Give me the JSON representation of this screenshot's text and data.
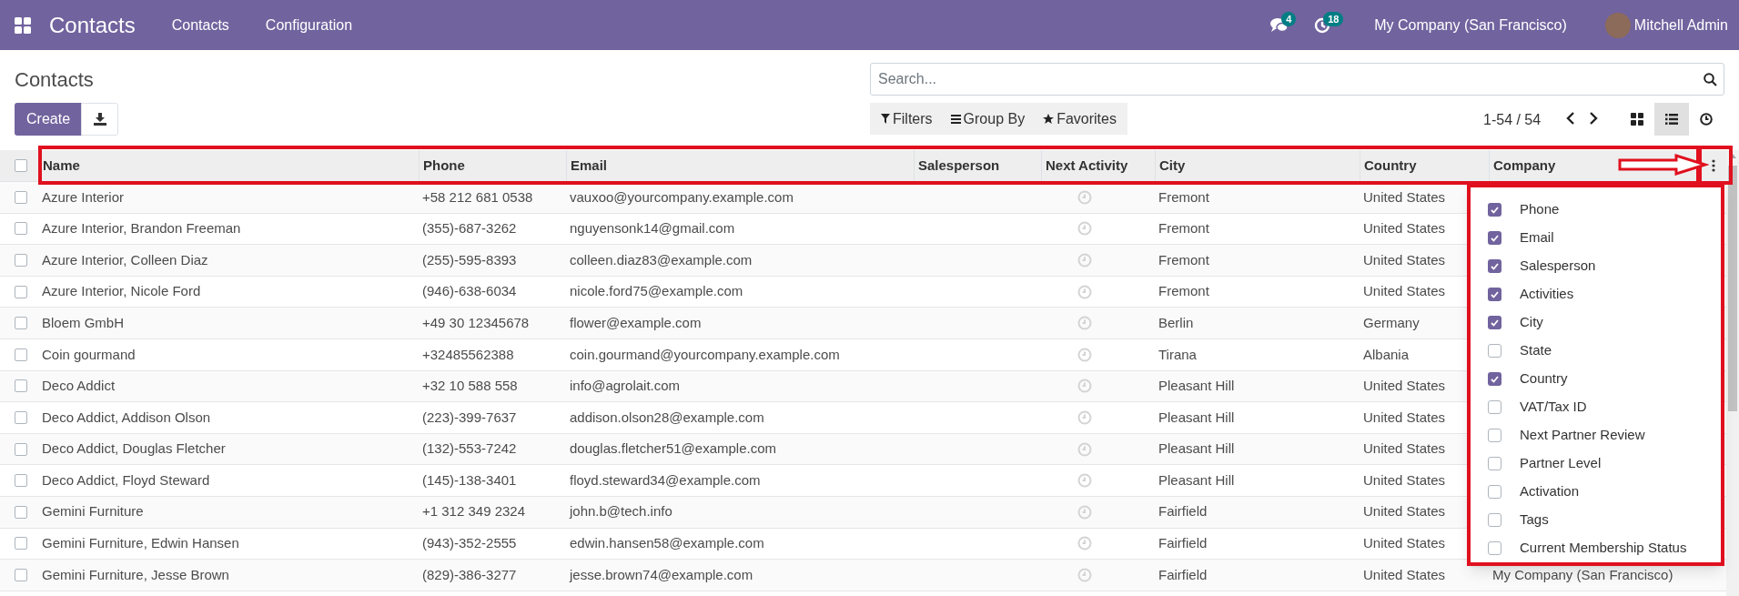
{
  "navbar": {
    "app_title": "Contacts",
    "menu": [
      "Contacts",
      "Configuration"
    ],
    "messages_badge": "4",
    "activities_badge": "18",
    "company": "My Company (San Francisco)",
    "user": "Mitchell Admin"
  },
  "breadcrumb": "Contacts",
  "buttons": {
    "create": "Create"
  },
  "search": {
    "placeholder": "Search..."
  },
  "filters": [
    "Filters",
    "Group By",
    "Favorites"
  ],
  "pager": "1-54 / 54",
  "views": [
    {
      "kind": "kanban",
      "selected": false
    },
    {
      "kind": "list",
      "selected": true
    },
    {
      "kind": "activity",
      "selected": false
    }
  ],
  "table": {
    "all_selected": false,
    "columns": [
      "Name",
      "Phone",
      "Email",
      "Salesperson",
      "Next Activity",
      "City",
      "Country",
      "Company"
    ],
    "rows": [
      {
        "selected": false,
        "name": "Azure Interior",
        "phone": "+58 212 681 0538",
        "email": "vauxoo@yourcompany.example.com",
        "city": "Fremont",
        "country": "United States"
      },
      {
        "selected": false,
        "name": "Azure Interior, Brandon Freeman",
        "phone": "(355)-687-3262",
        "email": "nguyensonk14@gmail.com",
        "city": "Fremont",
        "country": "United States"
      },
      {
        "selected": false,
        "name": "Azure Interior, Colleen Diaz",
        "phone": "(255)-595-8393",
        "email": "colleen.diaz83@example.com",
        "city": "Fremont",
        "country": "United States"
      },
      {
        "selected": false,
        "name": "Azure Interior, Nicole Ford",
        "phone": "(946)-638-6034",
        "email": "nicole.ford75@example.com",
        "city": "Fremont",
        "country": "United States"
      },
      {
        "selected": false,
        "name": "Bloem GmbH",
        "phone": "+49 30 12345678",
        "email": "flower@example.com",
        "city": "Berlin",
        "country": "Germany"
      },
      {
        "selected": false,
        "name": "Coin gourmand",
        "phone": "+32485562388",
        "email": "coin.gourmand@yourcompany.example.com",
        "city": "Tirana",
        "country": "Albania"
      },
      {
        "selected": false,
        "name": "Deco Addict",
        "phone": "+32 10 588 558",
        "email": "info@agrolait.com",
        "city": "Pleasant Hill",
        "country": "United States"
      },
      {
        "selected": false,
        "name": "Deco Addict, Addison Olson",
        "phone": "(223)-399-7637",
        "email": "addison.olson28@example.com",
        "city": "Pleasant Hill",
        "country": "United States"
      },
      {
        "selected": false,
        "name": "Deco Addict, Douglas Fletcher",
        "phone": "(132)-553-7242",
        "email": "douglas.fletcher51@example.com",
        "city": "Pleasant Hill",
        "country": "United States"
      },
      {
        "selected": false,
        "name": "Deco Addict, Floyd Steward",
        "phone": "(145)-138-3401",
        "email": "floyd.steward34@example.com",
        "city": "Pleasant Hill",
        "country": "United States"
      },
      {
        "selected": false,
        "name": "Gemini Furniture",
        "phone": "+1 312 349 2324",
        "email": "john.b@tech.info",
        "city": "Fairfield",
        "country": "United States"
      },
      {
        "selected": false,
        "name": "Gemini Furniture, Edwin Hansen",
        "phone": "(943)-352-2555",
        "email": "edwin.hansen58@example.com",
        "city": "Fairfield",
        "country": "United States"
      },
      {
        "selected": false,
        "name": "Gemini Furniture, Jesse Brown",
        "phone": "(829)-386-3277",
        "email": "jesse.brown74@example.com",
        "city": "Fairfield",
        "country": "United States",
        "company": "My Company (San Francisco)"
      }
    ]
  },
  "optional_columns": [
    {
      "label": "Phone",
      "checked": true
    },
    {
      "label": "Email",
      "checked": true
    },
    {
      "label": "Salesperson",
      "checked": true
    },
    {
      "label": "Activities",
      "checked": true
    },
    {
      "label": "City",
      "checked": true
    },
    {
      "label": "State",
      "checked": false
    },
    {
      "label": "Country",
      "checked": true
    },
    {
      "label": "VAT/Tax ID",
      "checked": false
    },
    {
      "label": "Next Partner Review",
      "checked": false
    },
    {
      "label": "Partner Level",
      "checked": false
    },
    {
      "label": "Activation",
      "checked": false
    },
    {
      "label": "Tags",
      "checked": false
    },
    {
      "label": "Current Membership Status",
      "checked": false
    }
  ]
}
